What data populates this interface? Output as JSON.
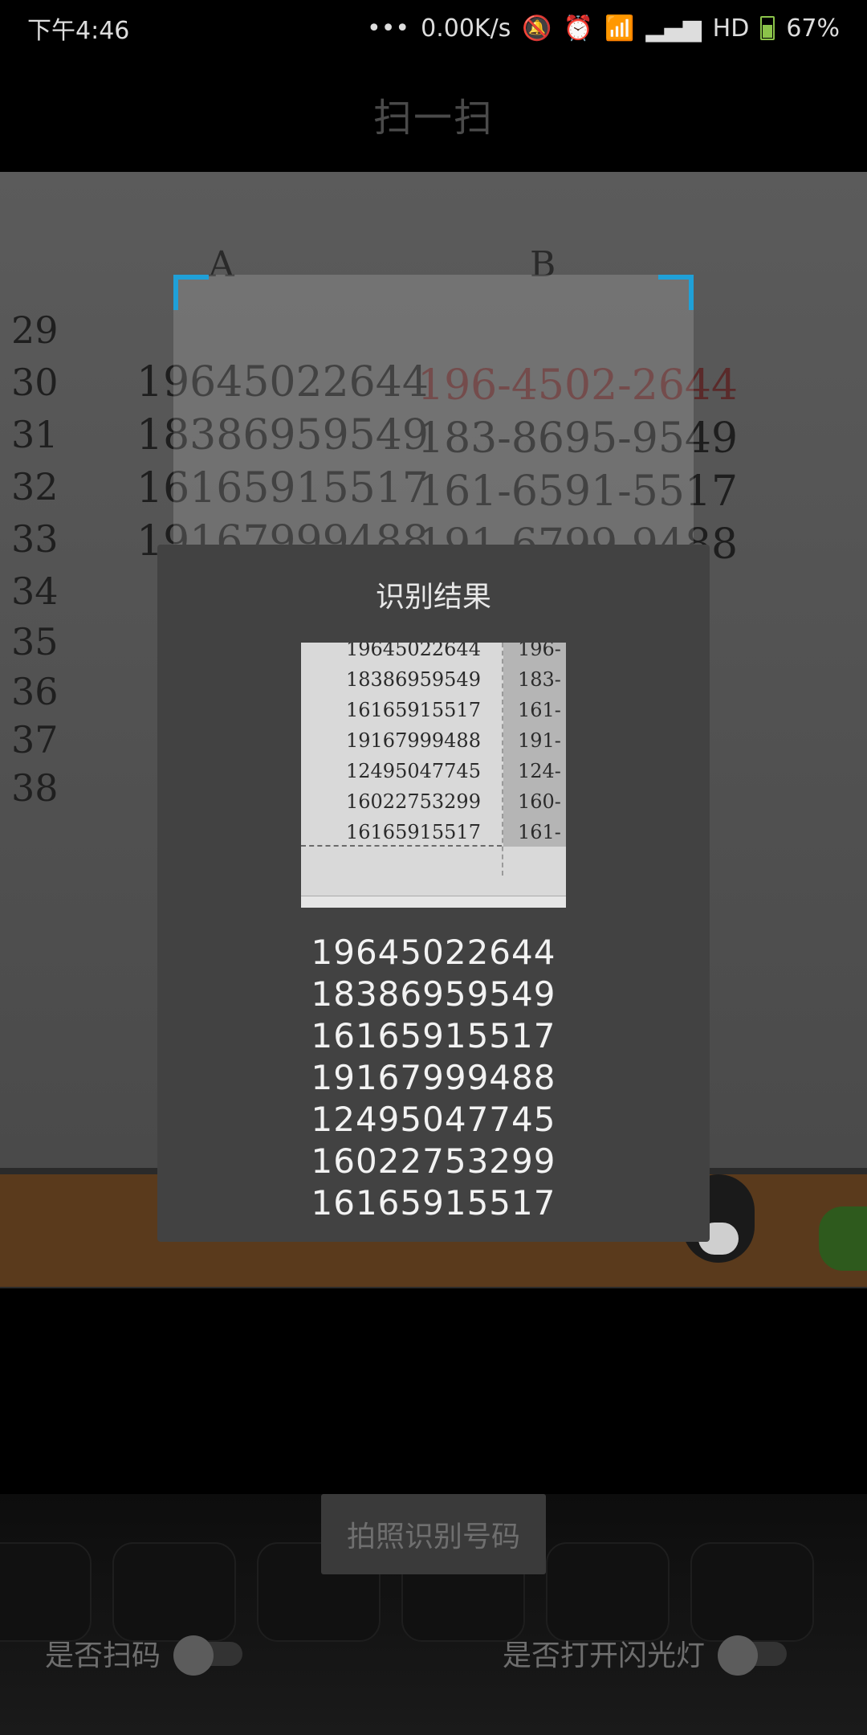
{
  "status_bar": {
    "time": "下午4:46",
    "dots": "•••",
    "network_speed": "0.00K/s",
    "mute_icon": "🔕",
    "alarm_icon": "⏰",
    "wifi_icon": "📶",
    "signal_icon": "▂▄▆",
    "hd": "HD",
    "battery": "67%"
  },
  "app_bar": {
    "title": "扫一扫"
  },
  "camera_preview": {
    "column_headers": [
      "A",
      "B"
    ],
    "rows": [
      {
        "n": "29",
        "a": "",
        "b": ""
      },
      {
        "n": "30",
        "a": "19645022644",
        "b": "196-4502-2644"
      },
      {
        "n": "31",
        "a": "18386959549",
        "b": "183-8695-9549"
      },
      {
        "n": "32",
        "a": "16165915517",
        "b": "161-6591-5517"
      },
      {
        "n": "33",
        "a": "19167999488",
        "b": "191-6799-9488"
      },
      {
        "n": "34",
        "a": "",
        "b": ""
      },
      {
        "n": "35",
        "a": "",
        "b": ""
      },
      {
        "n": "36",
        "a": "",
        "b": ""
      },
      {
        "n": "37",
        "a": "",
        "b": ""
      },
      {
        "n": "38",
        "a": "",
        "b": ""
      }
    ]
  },
  "dialog": {
    "title": "识别结果",
    "thumbnail_rows": [
      {
        "a": "19645022644",
        "b": "196-"
      },
      {
        "a": "18386959549",
        "b": "183-"
      },
      {
        "a": "16165915517",
        "b": "161-"
      },
      {
        "a": "19167999488",
        "b": "191-"
      },
      {
        "a": "12495047745",
        "b": "124-"
      },
      {
        "a": "16022753299",
        "b": "160-"
      },
      {
        "a": "16165915517",
        "b": "161-"
      }
    ],
    "results": [
      "19645022644",
      "18386959549",
      "16165915517",
      "19167999488",
      "12495047745",
      "16022753299",
      "16165915517"
    ]
  },
  "controls": {
    "capture_button": "拍照识别号码",
    "scan_toggle_label": "是否扫码",
    "scan_toggle_on": false,
    "flash_toggle_label": "是否打开闪光灯",
    "flash_toggle_on": false
  }
}
